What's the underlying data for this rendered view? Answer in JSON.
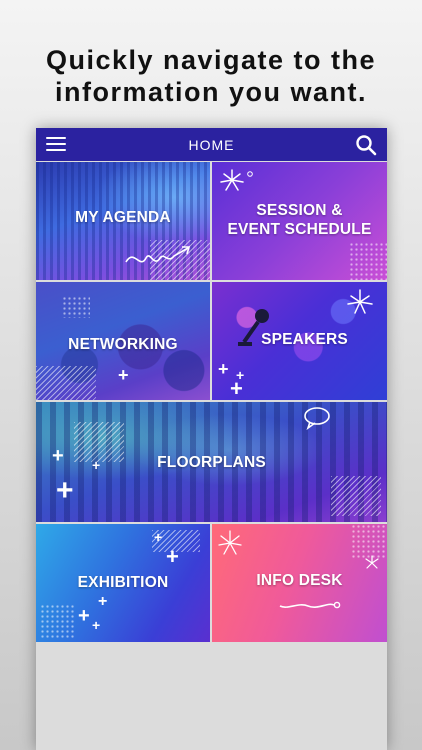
{
  "headline": "Quickly navigate to the information you want.",
  "topbar": {
    "title": "HOME",
    "menu_icon": "hamburger-menu-icon",
    "search_icon": "search-icon",
    "color": "#2b22a0"
  },
  "tiles": [
    {
      "id": "my-agenda",
      "label": "MY AGENDA"
    },
    {
      "id": "session-schedule",
      "label_line1": "SESSION &",
      "label_line2": "EVENT SCHEDULE"
    },
    {
      "id": "networking",
      "label": "NETWORKING"
    },
    {
      "id": "speakers",
      "label": "SPEAKERS"
    },
    {
      "id": "floorplans",
      "label": "FLOORPLANS"
    },
    {
      "id": "exhibition",
      "label": "EXHIBITION"
    },
    {
      "id": "info-desk",
      "label": "INFO DESK"
    }
  ],
  "colors": {
    "purple": "#5b2fd6",
    "blue": "#2f4fd8",
    "magenta": "#c03fd0",
    "pink": "#ff6a7c"
  }
}
